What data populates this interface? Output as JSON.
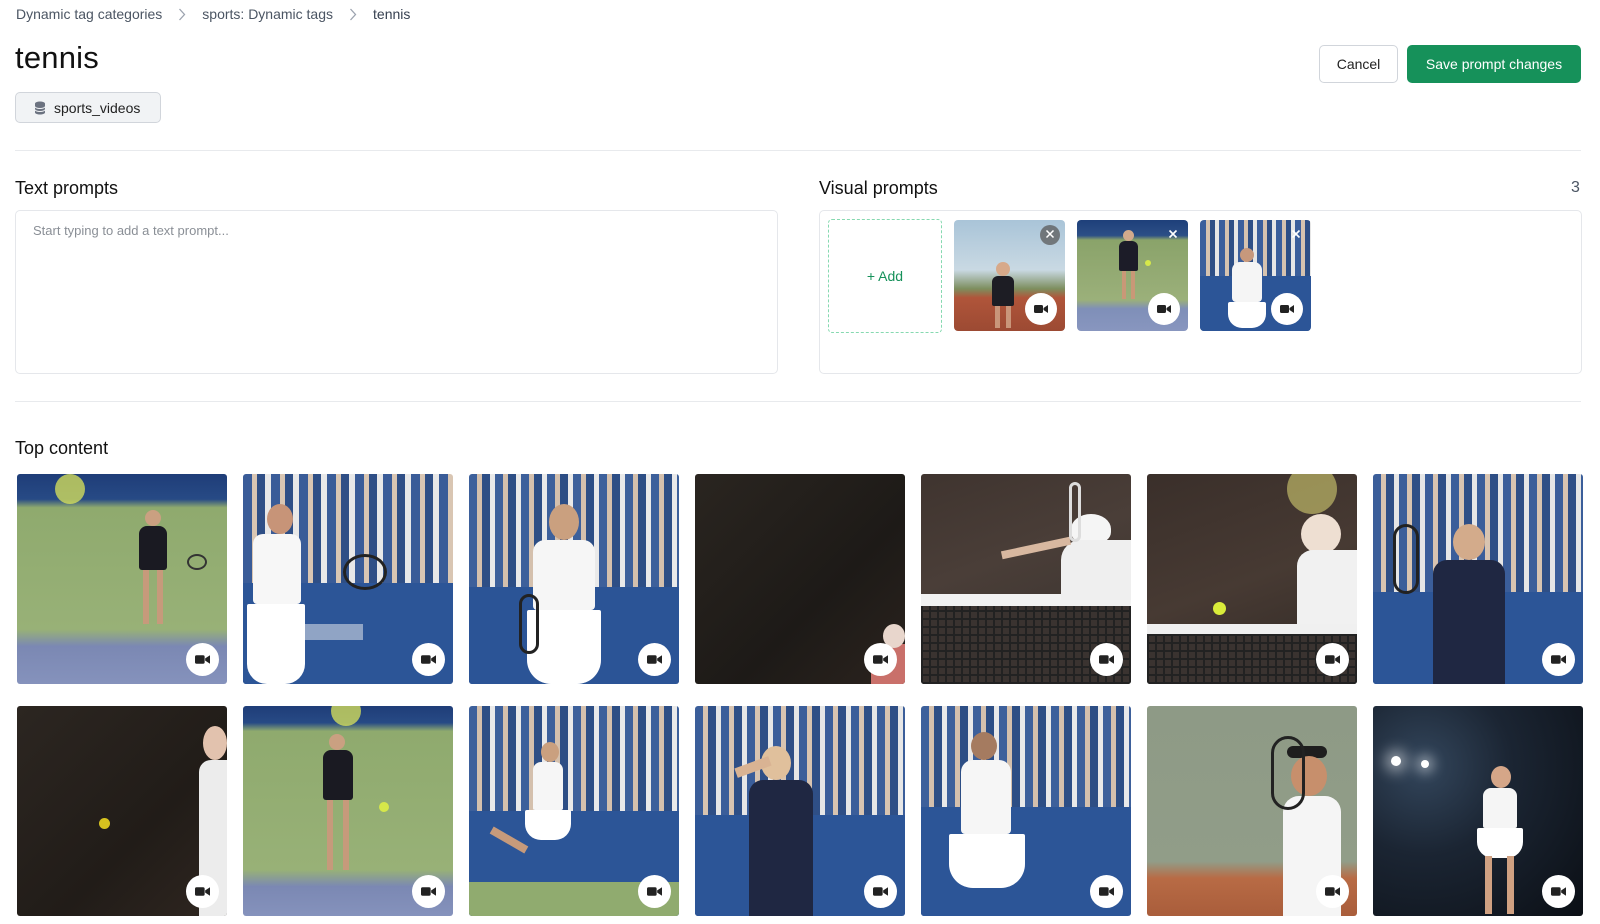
{
  "breadcrumb": {
    "items": [
      "Dynamic tag categories",
      "sports: Dynamic tags",
      "tennis"
    ]
  },
  "page": {
    "title": "tennis",
    "database_chip": "sports_videos"
  },
  "actions": {
    "cancel_label": "Cancel",
    "save_label": "Save prompt changes"
  },
  "text_prompts": {
    "title": "Text prompts",
    "placeholder": "Start typing to add a text prompt..."
  },
  "visual_prompts": {
    "title": "Visual prompts",
    "count": "3",
    "add_label": "+ Add"
  },
  "top_content": {
    "title": "Top content"
  },
  "colors": {
    "accent": "#16915a",
    "accent_dashed_border": "#86d9b0",
    "divider": "#e8eaed"
  },
  "icons": {
    "breadcrumb_separator": "chevron-right-icon",
    "database": "database-icon",
    "video_badge": "video-camera-icon",
    "remove": "close-icon"
  }
}
